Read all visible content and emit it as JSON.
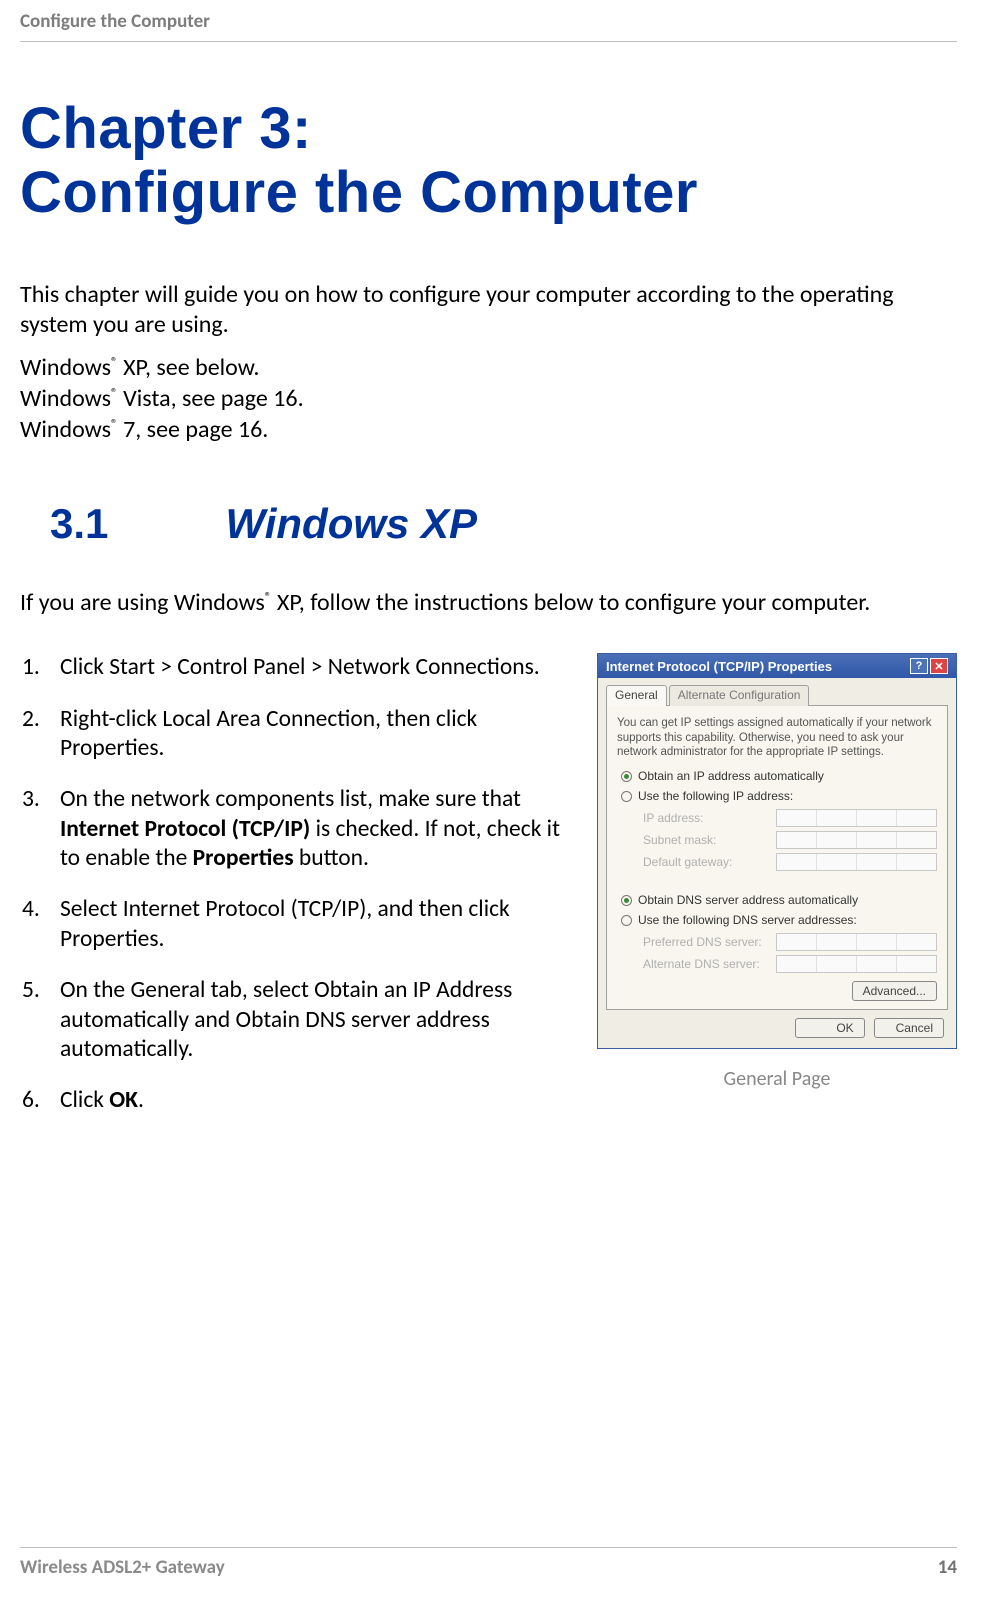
{
  "header": {
    "running_title": "Configure the Computer"
  },
  "chapter": {
    "line1": "Chapter 3:",
    "line2": "Configure the Computer"
  },
  "intro": "This chapter will guide you on how to configure your computer according to the operating system you are using.",
  "os_lines": {
    "xp": " XP, see below.",
    "vista": " Vista, see page 16.",
    "w7": " 7, see page 16."
  },
  "section": {
    "num": "3.1",
    "title": "Windows XP"
  },
  "section_intro_a": "If you are using Windows",
  "section_intro_b": " XP, follow the instructions below to configure your computer.",
  "steps": {
    "s1": "Click Start > Control Panel > Network Connections.",
    "s2": "Right-click Local Area Connection, then click Properties.",
    "s3a": "On the network components list, make sure that ",
    "s3b": "Internet Protocol (TCP/IP)",
    "s3c": " is checked. If not, check it to enable the ",
    "s3d": "Properties",
    "s3e": " button.",
    "s4": "Select Internet Protocol (TCP/IP), and then click Properties.",
    "s5": "On the General tab, select Obtain an IP Address automatically and Obtain DNS server address automatically.",
    "s6a": "Click ",
    "s6b": "OK",
    "s6c": "."
  },
  "dialog": {
    "title": "Internet Protocol (TCP/IP) Properties",
    "help_glyph": "?",
    "close_glyph": "✕",
    "tabs": {
      "general": "General",
      "alt": "Alternate Configuration"
    },
    "desc": "You can get IP settings assigned automatically if your network supports this capability. Otherwise, you need to ask your network administrator for the appropriate IP settings.",
    "radio_auto_ip": "Obtain an IP address automatically",
    "radio_manual_ip": "Use the following IP address:",
    "ip_label": "IP address:",
    "subnet_label": "Subnet mask:",
    "gateway_label": "Default gateway:",
    "radio_auto_dns": "Obtain DNS server address automatically",
    "radio_manual_dns": "Use the following DNS server addresses:",
    "pref_dns": "Preferred DNS server:",
    "alt_dns": "Alternate DNS server:",
    "advanced": "Advanced...",
    "ok": "OK",
    "cancel": "Cancel"
  },
  "caption": "General Page",
  "footer": {
    "product": "Wireless ADSL2+ Gateway",
    "page": "14"
  },
  "reg_mark": "®"
}
